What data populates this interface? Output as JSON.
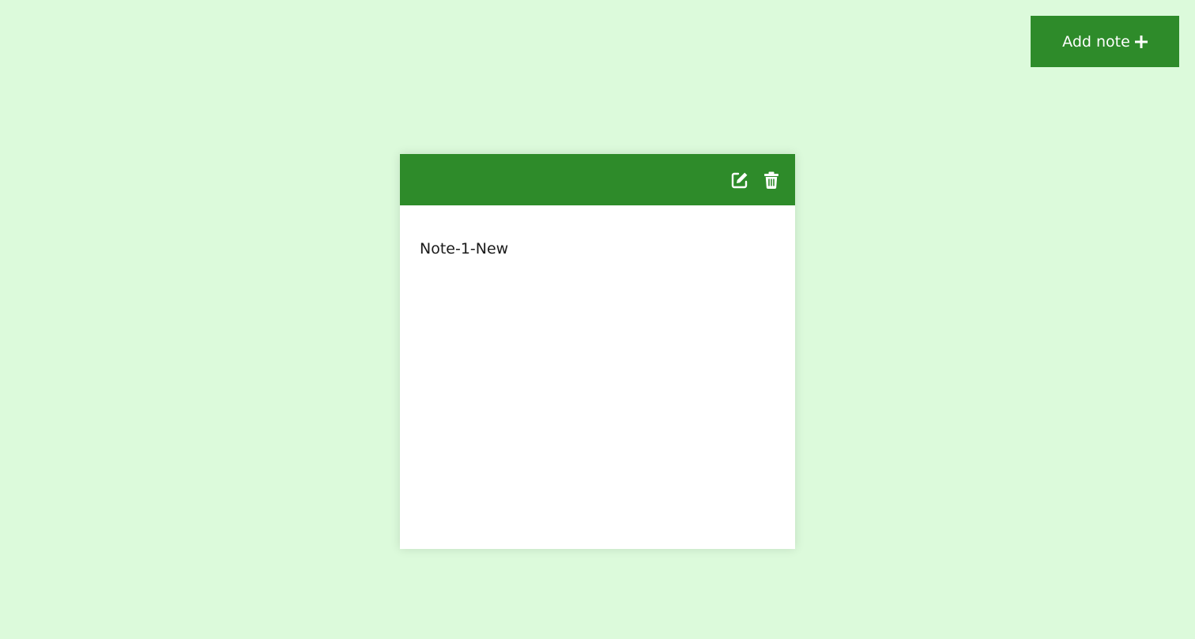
{
  "header": {
    "add_button_label": "Add note",
    "add_icon": "plus-icon"
  },
  "notes": [
    {
      "text": "Note-1-New",
      "actions": [
        {
          "icon": "edit-icon"
        },
        {
          "icon": "trash-icon"
        }
      ]
    }
  ],
  "colors": {
    "background": "#dcfadb",
    "accent": "#2e8b2a",
    "note_body": "#ffffff"
  }
}
